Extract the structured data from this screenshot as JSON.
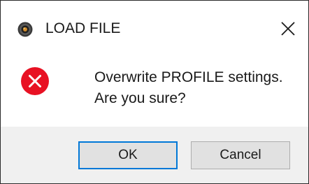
{
  "window": {
    "title": "LOAD FILE",
    "app_icon": "app-logo-icon",
    "close_icon": "close-icon"
  },
  "message": {
    "icon": "error-icon",
    "icon_color": "#e81123",
    "line1": "Overwrite PROFILE settings.",
    "line2": "Are you sure?"
  },
  "buttons": {
    "ok_label": "OK",
    "cancel_label": "Cancel"
  },
  "colors": {
    "focus_border": "#0078d7",
    "footer_bg": "#f0f0f0"
  }
}
